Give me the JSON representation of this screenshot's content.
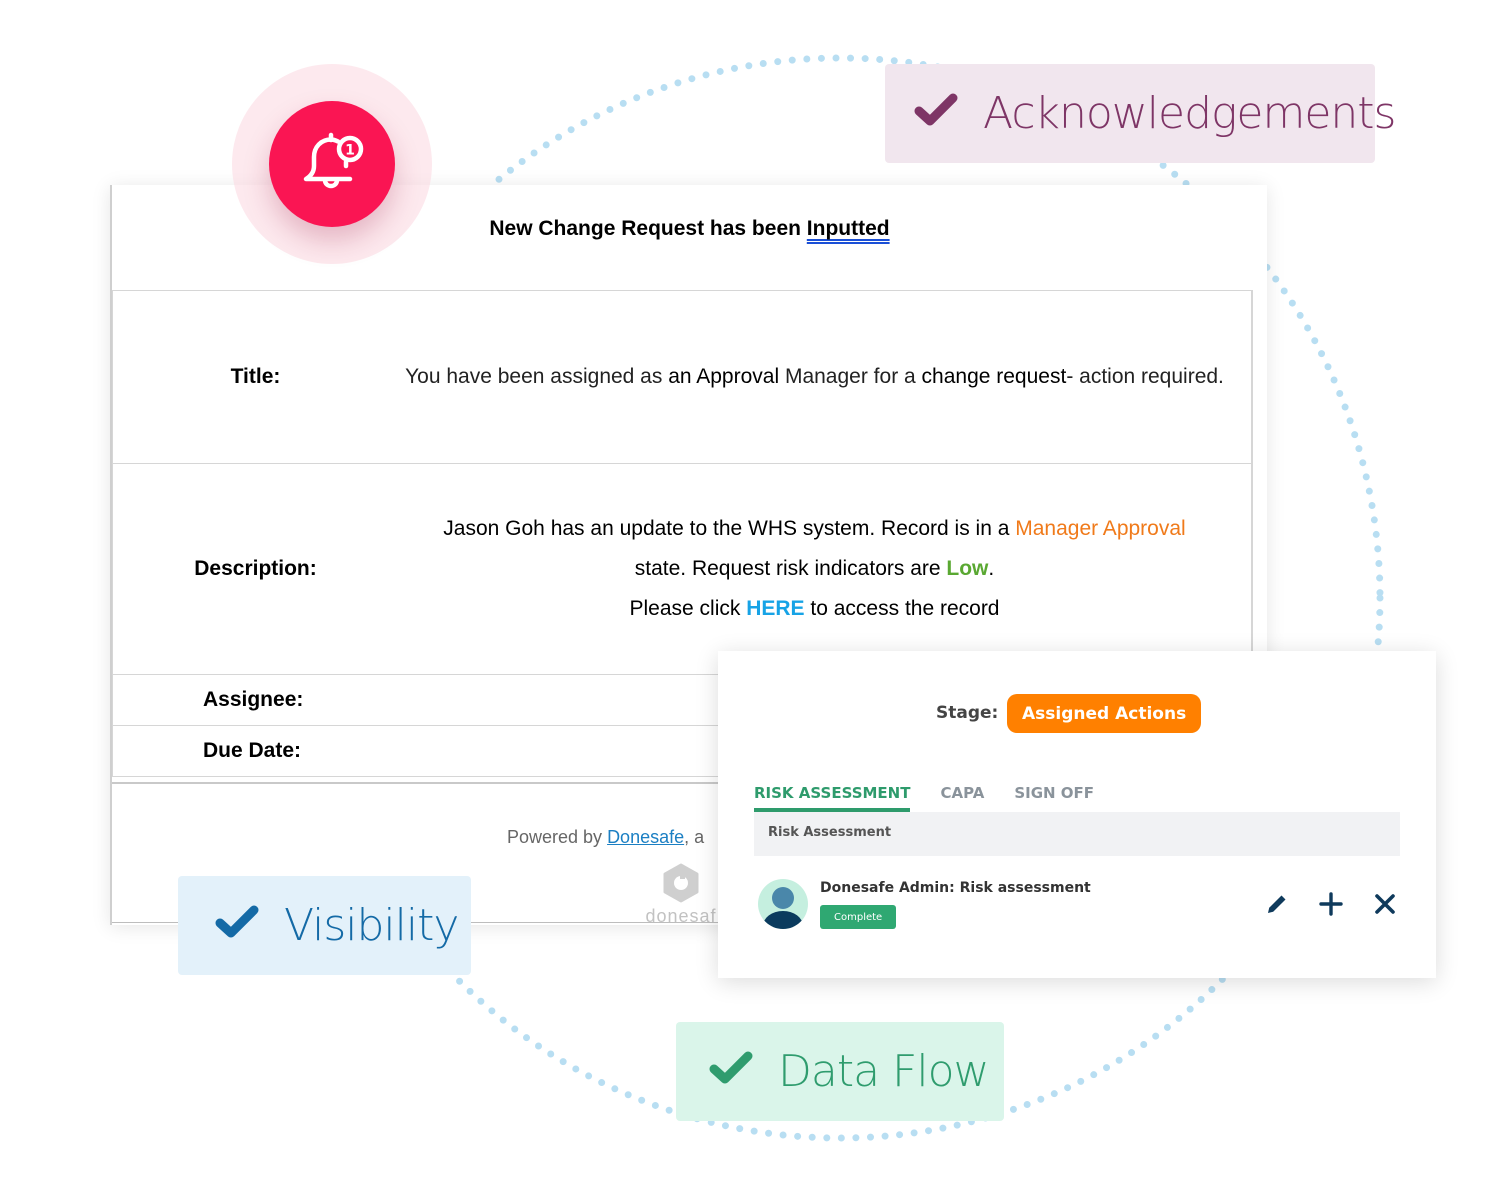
{
  "email": {
    "heading_prefix": "New Change Request has been ",
    "heading_link": "Inputted",
    "rows": {
      "title": {
        "label": "Title:",
        "parts": [
          "You have been assigned as ",
          "an Approval",
          " Manager for a ",
          "change request",
          "- action required."
        ]
      },
      "description": {
        "label": "Description:",
        "line1_a": "Jason Goh has an update to the WHS system. Record is in a ",
        "line1_state": "Manager Approval",
        "line2_a": "state. Request risk indicators are ",
        "line2_risk": "Low",
        "line2_b": ".",
        "line3_a": "Please click ",
        "line3_link": "HERE",
        "line3_b": " to access the record"
      },
      "assignee": {
        "label": "Assignee:"
      },
      "due_date": {
        "label": "Due Date:"
      }
    },
    "footer": {
      "powered_prefix": "Powered by ",
      "powered_link": "Donesafe",
      "powered_suffix": ", a",
      "logo_word": "donesaf"
    }
  },
  "notification": {
    "icon": "bell-icon",
    "count": "1",
    "color": "#fa1553"
  },
  "tags": {
    "acknowledgements": {
      "label": "Acknowledgements",
      "color": "#7e3566"
    },
    "visibility": {
      "label": "Visibility",
      "color": "#146aa6"
    },
    "data_flow": {
      "label": "Data Flow",
      "color": "#2f9c6e"
    }
  },
  "stage_card": {
    "stage_label": "Stage:",
    "stage_value": "Assigned Actions",
    "stage_color": "#ff8000",
    "tabs": [
      {
        "label": "RISK ASSESSMENT",
        "active": true
      },
      {
        "label": "CAPA",
        "active": false
      },
      {
        "label": "SIGN OFF",
        "active": false
      }
    ],
    "panel_title": "Risk Assessment",
    "item": {
      "title": "Donesafe Admin: Risk assessment",
      "status": "Complete",
      "actions": [
        "edit-icon",
        "add-icon",
        "close-icon"
      ]
    }
  }
}
